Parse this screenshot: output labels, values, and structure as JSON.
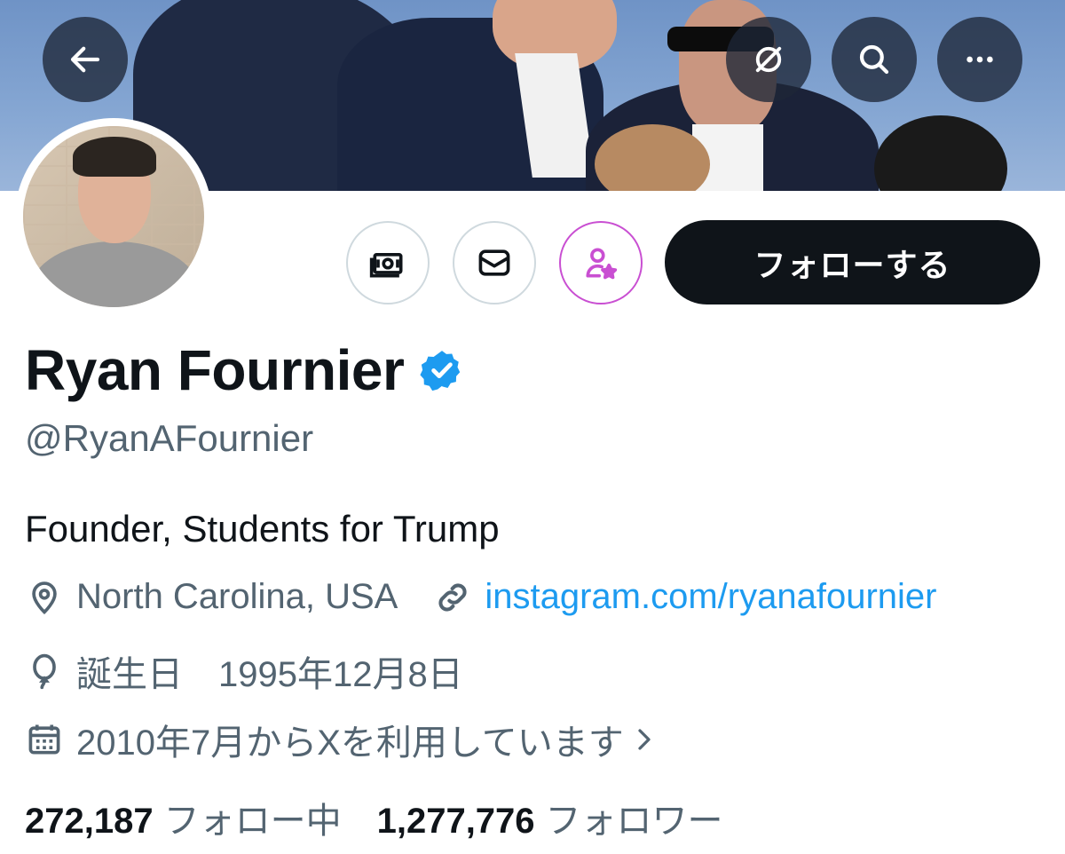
{
  "profile": {
    "name": "Ryan Fournier",
    "handle": "@RyanAFournier",
    "bio": "Founder, Students for Trump",
    "location": "North Carolina, USA",
    "website": "instagram.com/ryanafournier",
    "birthday": "誕生日　1995年12月8日",
    "joined": "2010年7月からXを利用しています",
    "following_count": "272,187",
    "following_label": "フォロー中",
    "followers_count": "1,277,776",
    "followers_label": "フォロワー"
  },
  "actions": {
    "follow_label": "フォローする"
  },
  "icons": {
    "back": "arrow-left-icon",
    "grok": "grok-icon",
    "search": "search-icon",
    "more": "more-icon",
    "tip": "money-icon",
    "message": "envelope-icon",
    "subscribe": "person-star-icon",
    "verified": "verified-badge-icon",
    "location": "location-pin-icon",
    "link": "link-icon",
    "birthday": "balloon-icon",
    "calendar": "calendar-icon"
  },
  "colors": {
    "verified": "#1d9bf0",
    "link": "#1d9bf0",
    "subscribe": "#c94fd2",
    "follow_button": "#0f1419"
  }
}
